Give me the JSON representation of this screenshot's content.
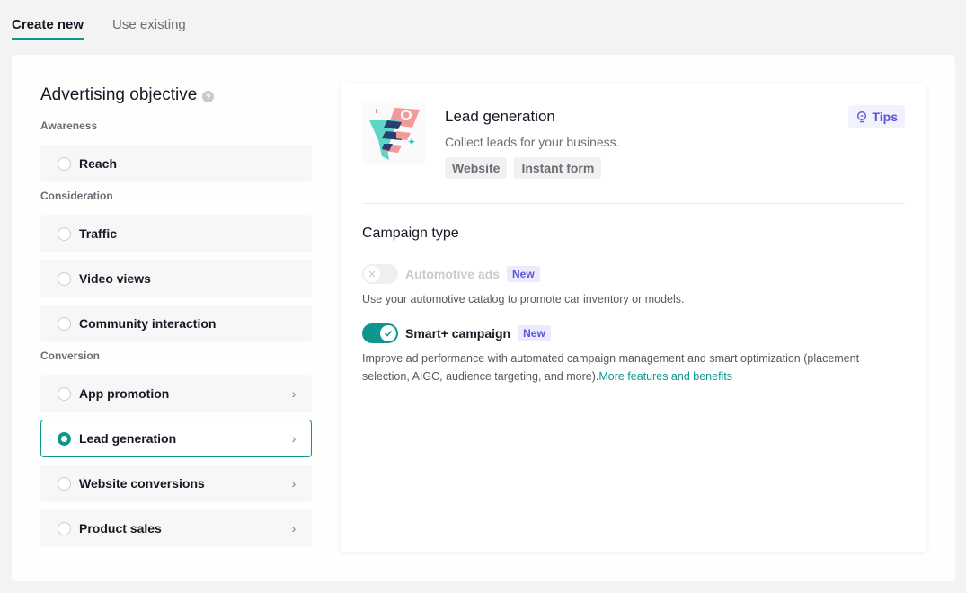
{
  "tabs": [
    {
      "label": "Create new",
      "active": true
    },
    {
      "label": "Use existing",
      "active": false
    }
  ],
  "objective": {
    "title": "Advertising objective",
    "help_icon": "question-circle-icon",
    "groups": [
      {
        "label": "Awareness",
        "options": [
          {
            "label": "Reach",
            "selected": false,
            "chevron": false
          }
        ]
      },
      {
        "label": "Consideration",
        "options": [
          {
            "label": "Traffic",
            "selected": false,
            "chevron": false
          },
          {
            "label": "Video views",
            "selected": false,
            "chevron": false
          },
          {
            "label": "Community interaction",
            "selected": false,
            "chevron": false
          }
        ]
      },
      {
        "label": "Conversion",
        "options": [
          {
            "label": "App promotion",
            "selected": false,
            "chevron": true
          },
          {
            "label": "Lead generation",
            "selected": true,
            "chevron": true
          },
          {
            "label": "Website conversions",
            "selected": false,
            "chevron": true
          },
          {
            "label": "Product sales",
            "selected": false,
            "chevron": true
          }
        ]
      }
    ]
  },
  "detail": {
    "title": "Lead generation",
    "description": "Collect leads for your business.",
    "tags": [
      "Website",
      "Instant form"
    ],
    "tips_label": "Tips",
    "campaign_type": {
      "title": "Campaign type",
      "items": [
        {
          "label": "Automotive ads",
          "badge": "New",
          "enabled": false,
          "disabled": true,
          "description": "Use your automotive catalog to promote car inventory or models.",
          "link": ""
        },
        {
          "label": "Smart+ campaign",
          "badge": "New",
          "enabled": true,
          "disabled": false,
          "description": "Improve ad performance with automated campaign management and smart optimization (placement selection, AIGC, audience targeting, and more).",
          "link": "More features and benefits"
        }
      ]
    }
  },
  "colors": {
    "accent": "#0f978d",
    "badge": "#5e55d8",
    "badge_bg": "#eceafd"
  }
}
